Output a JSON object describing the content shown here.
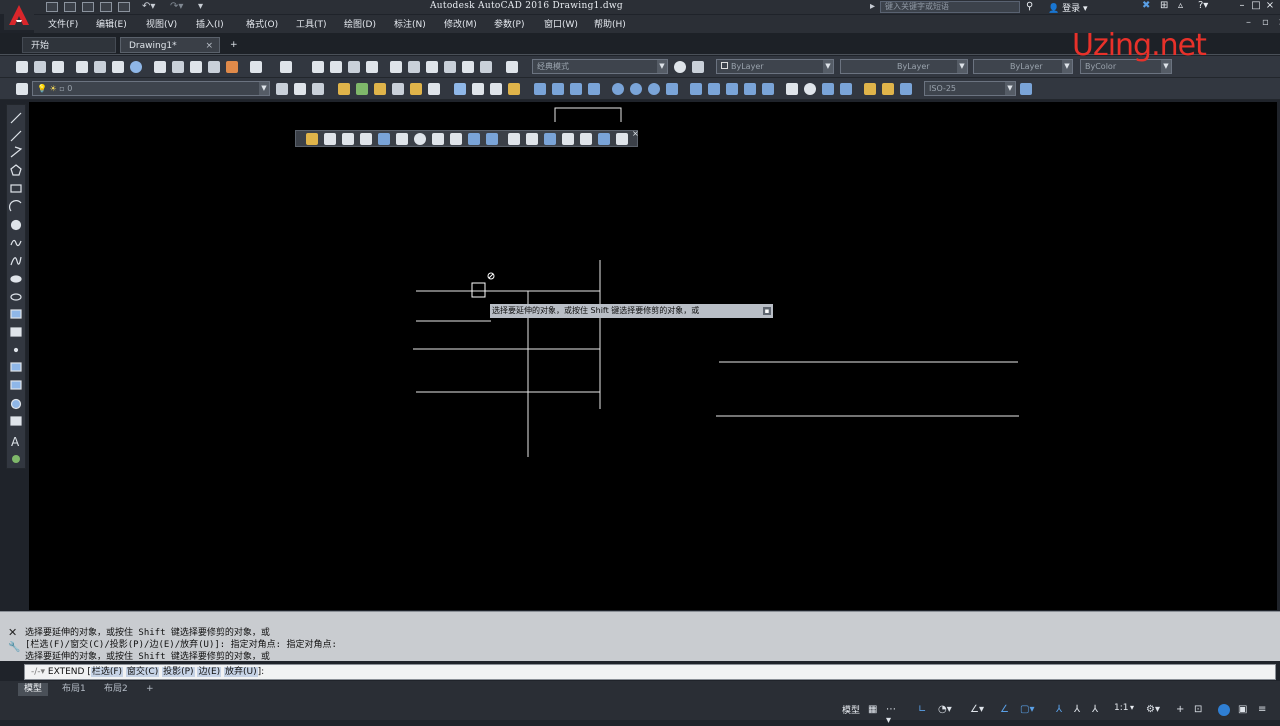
{
  "app": {
    "title": "Autodesk AutoCAD 2016    Drawing1.dwg",
    "search_placeholder": "键入关键字或短语",
    "login_label": "登录",
    "watermark": "Uzing.net"
  },
  "menubar": [
    "文件(F)",
    "编辑(E)",
    "视图(V)",
    "插入(I)",
    "格式(O)",
    "工具(T)",
    "绘图(D)",
    "标注(N)",
    "修改(M)",
    "参数(P)",
    "窗口(W)",
    "帮助(H)"
  ],
  "tabs": {
    "start": "开始",
    "drawing": "Drawing1*",
    "add": "+"
  },
  "toolbar": {
    "workspace": "经典模式",
    "color": "ByLayer",
    "linetype": "ByLayer",
    "lineweight": "ByLayer",
    "plotstyle": "ByColor",
    "layer": "0",
    "dimstyle": "ISO-25"
  },
  "tooltip": {
    "text": "选择要延伸的对象，或按住 Shift 键选择要修剪的对象，或"
  },
  "command": {
    "history": [
      "选择要延伸的对象，或按住 Shift 键选择要修剪的对象，或",
      "[栏选(F)/窗交(C)/投影(P)/边(E)/放弃(U)]:  指定对角点: 指定对角点:",
      "选择要延伸的对象，或按住 Shift 键选择要修剪的对象，或"
    ],
    "prompt_prefix": "EXTEND [",
    "options": [
      "栏选(F)",
      "窗交(C)",
      "投影(P)",
      "边(E)",
      "放弃(U)"
    ],
    "prompt_suffix": "]:"
  },
  "layout_tabs": [
    "模型",
    "布局1",
    "布局2",
    "+"
  ],
  "status": {
    "model": "模型",
    "scale": "1:1"
  },
  "colors": {
    "accent": "#e8312a",
    "canvas": "#000000",
    "ui": "#323740"
  }
}
